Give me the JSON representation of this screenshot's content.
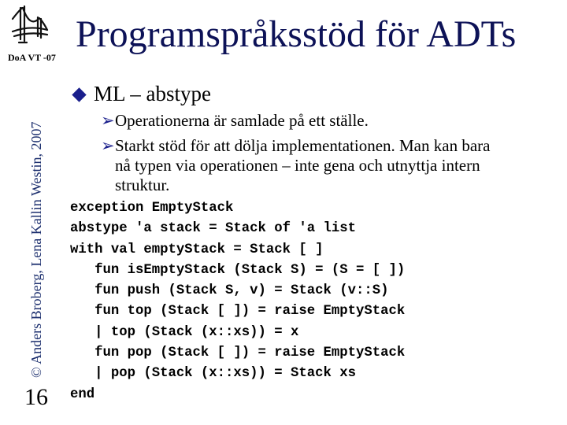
{
  "sidebar": {
    "logo_icon": "bridge-icon",
    "course_label": "DoA VT -07",
    "copyright": "© Anders Broberg, Lena Kallin Westin, 2007",
    "page_number": "16"
  },
  "slide": {
    "title": "Programspråksstöd för ADTs",
    "bullet": {
      "icon": "diamond-bullet-icon",
      "text": "ML – abstype",
      "subpoints": [
        {
          "icon": "arrow-bullet-icon",
          "lines": [
            "Operationerna är samlade på ett ställe."
          ]
        },
        {
          "icon": "arrow-bullet-icon",
          "lines": [
            "Starkt stöd för att dölja implementationen. Man kan bara",
            "nå typen via operationen – inte gena och utnyttja intern",
            "struktur."
          ]
        }
      ]
    },
    "code_lines": [
      "exception EmptyStack",
      "abstype 'a stack = Stack of 'a list",
      "with val emptyStack = Stack [ ]",
      "   fun isEmptyStack (Stack S) = (S = [ ])",
      "   fun push (Stack S, v) = Stack (v::S)",
      "   fun top (Stack [ ]) = raise EmptyStack",
      "   | top (Stack (x::xs)) = x",
      "   fun pop (Stack [ ]) = raise EmptyStack",
      "   | pop (Stack (x::xs)) = Stack xs",
      "end"
    ]
  },
  "colors": {
    "title": "#0d1257",
    "bullet": "#1a1f8c",
    "copyright": "#1c2f6e"
  }
}
